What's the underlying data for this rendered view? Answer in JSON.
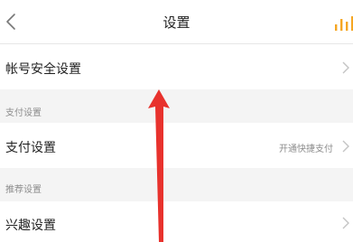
{
  "nav": {
    "title": "设置",
    "back_icon": "chevron-left-icon",
    "right_icon": "signal-bars-icon",
    "accent_color": "#f5a623"
  },
  "account": {
    "label": "帐号安全设置"
  },
  "payment": {
    "section_label": "支付设置",
    "row_label": "支付设置",
    "value": "开通快捷支付"
  },
  "recommend": {
    "section_label": "推荐设置",
    "row_label": "兴趣设置"
  },
  "annotation": {
    "arrow_color": "#e8322d"
  }
}
